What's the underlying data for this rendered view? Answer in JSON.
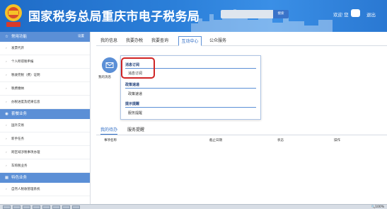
{
  "header": {
    "title": "国家税务总局重庆市电子税务局",
    "search_button": "搜索",
    "welcome": "欢迎",
    "user_prefix": "您",
    "logout": "退出"
  },
  "sidebar": {
    "sections": [
      {
        "label": "常用功能",
        "icon": "star-icon",
        "extra": "设置",
        "items": [
          "发票代开",
          "个人所得税申报",
          "税收完税（费）证明",
          "税费缴纳",
          "办税进度及结果信息"
        ]
      },
      {
        "label": "套餐业务",
        "icon": "package-icon",
        "items": [
          "国外交易",
          "新手任务",
          "跨区域涉税事项办理",
          "车购税业务"
        ]
      },
      {
        "label": "特色业务",
        "icon": "grid-icon",
        "items": [
          "自然人税收管理系统"
        ]
      }
    ]
  },
  "top_tabs": [
    "我的信息",
    "我要办税",
    "我要查询",
    "互动中心",
    "公众服务"
  ],
  "active_tab": "互动中心",
  "main_icon_label": "我的消息",
  "dropdown": {
    "sections": [
      {
        "title": "消息订阅",
        "items": [
          "消息订阅"
        ]
      },
      {
        "title": "政策速递",
        "items": [
          "政策速递"
        ]
      },
      {
        "title": "提示提醒",
        "items": [
          "服务提醒"
        ]
      }
    ]
  },
  "lower_tabs": [
    "我的待办",
    "服务提醒"
  ],
  "active_lower_tab": "我的待办",
  "table_headers": [
    "事项名称",
    "截止日期",
    "状态",
    "操作"
  ],
  "status_bar": {
    "zoom": "100%"
  },
  "colors": {
    "header_blue": "#2b7fd9",
    "accent": "#5b8fd6",
    "highlight_red": "#d02424"
  }
}
